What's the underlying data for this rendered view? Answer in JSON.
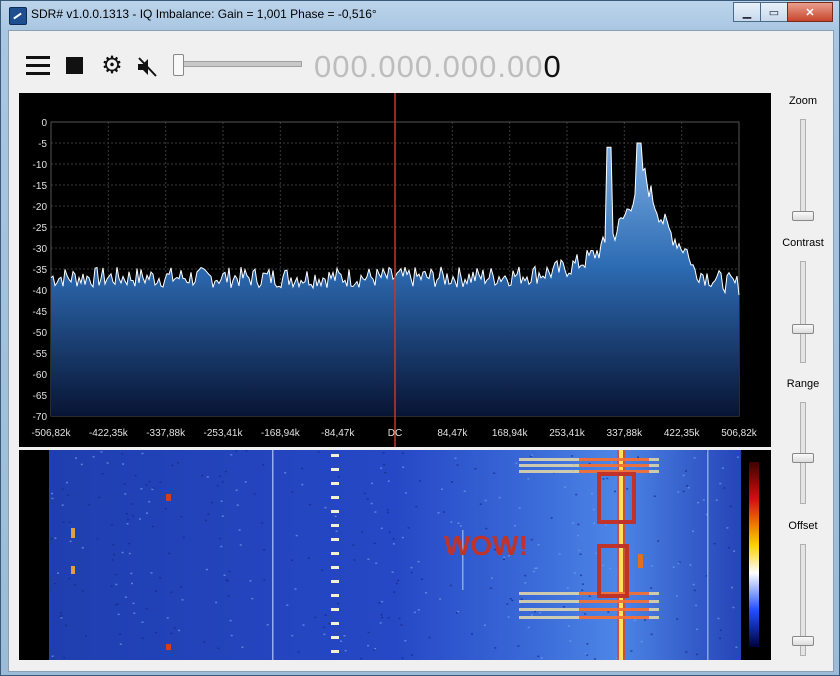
{
  "window": {
    "title": "SDR# v1.0.0.1313 - IQ Imbalance: Gain = 1,001 Phase = -0,516°",
    "minimize": "▁",
    "maximize": "▭",
    "close": "✕"
  },
  "toolbar": {
    "menu_icon": "hamburger-menu-icon",
    "stop_icon": "stop-icon",
    "settings_icon": "gear-icon",
    "mute_icon": "speaker-muted-icon",
    "frequency_dim": "000.000.000.00",
    "frequency_last": "0"
  },
  "spectrum": {
    "y_ticks": [
      "0",
      "-5",
      "-10",
      "-15",
      "-20",
      "-25",
      "-30",
      "-35",
      "-40",
      "-45",
      "-50",
      "-55",
      "-60",
      "-65",
      "-70"
    ],
    "x_ticks": [
      "-506,82k",
      "-422,35k",
      "-337,88k",
      "-253,41k",
      "-168,94k",
      "-84,47k",
      "DC",
      "84,47k",
      "168,94k",
      "253,41k",
      "337,88k",
      "422,35k",
      "506,82k"
    ],
    "colors": {
      "fill_top": "#6a9ed8",
      "fill_bottom": "#0a1a40",
      "center_line": "#c0392b",
      "trace": "#ffffff"
    }
  },
  "waterfall": {
    "annotation": "WOW!",
    "annotation_color": "#c0332b"
  },
  "side_panel": {
    "zoom_label": "Zoom",
    "contrast_label": "Contrast",
    "range_label": "Range",
    "offset_label": "Offset"
  }
}
